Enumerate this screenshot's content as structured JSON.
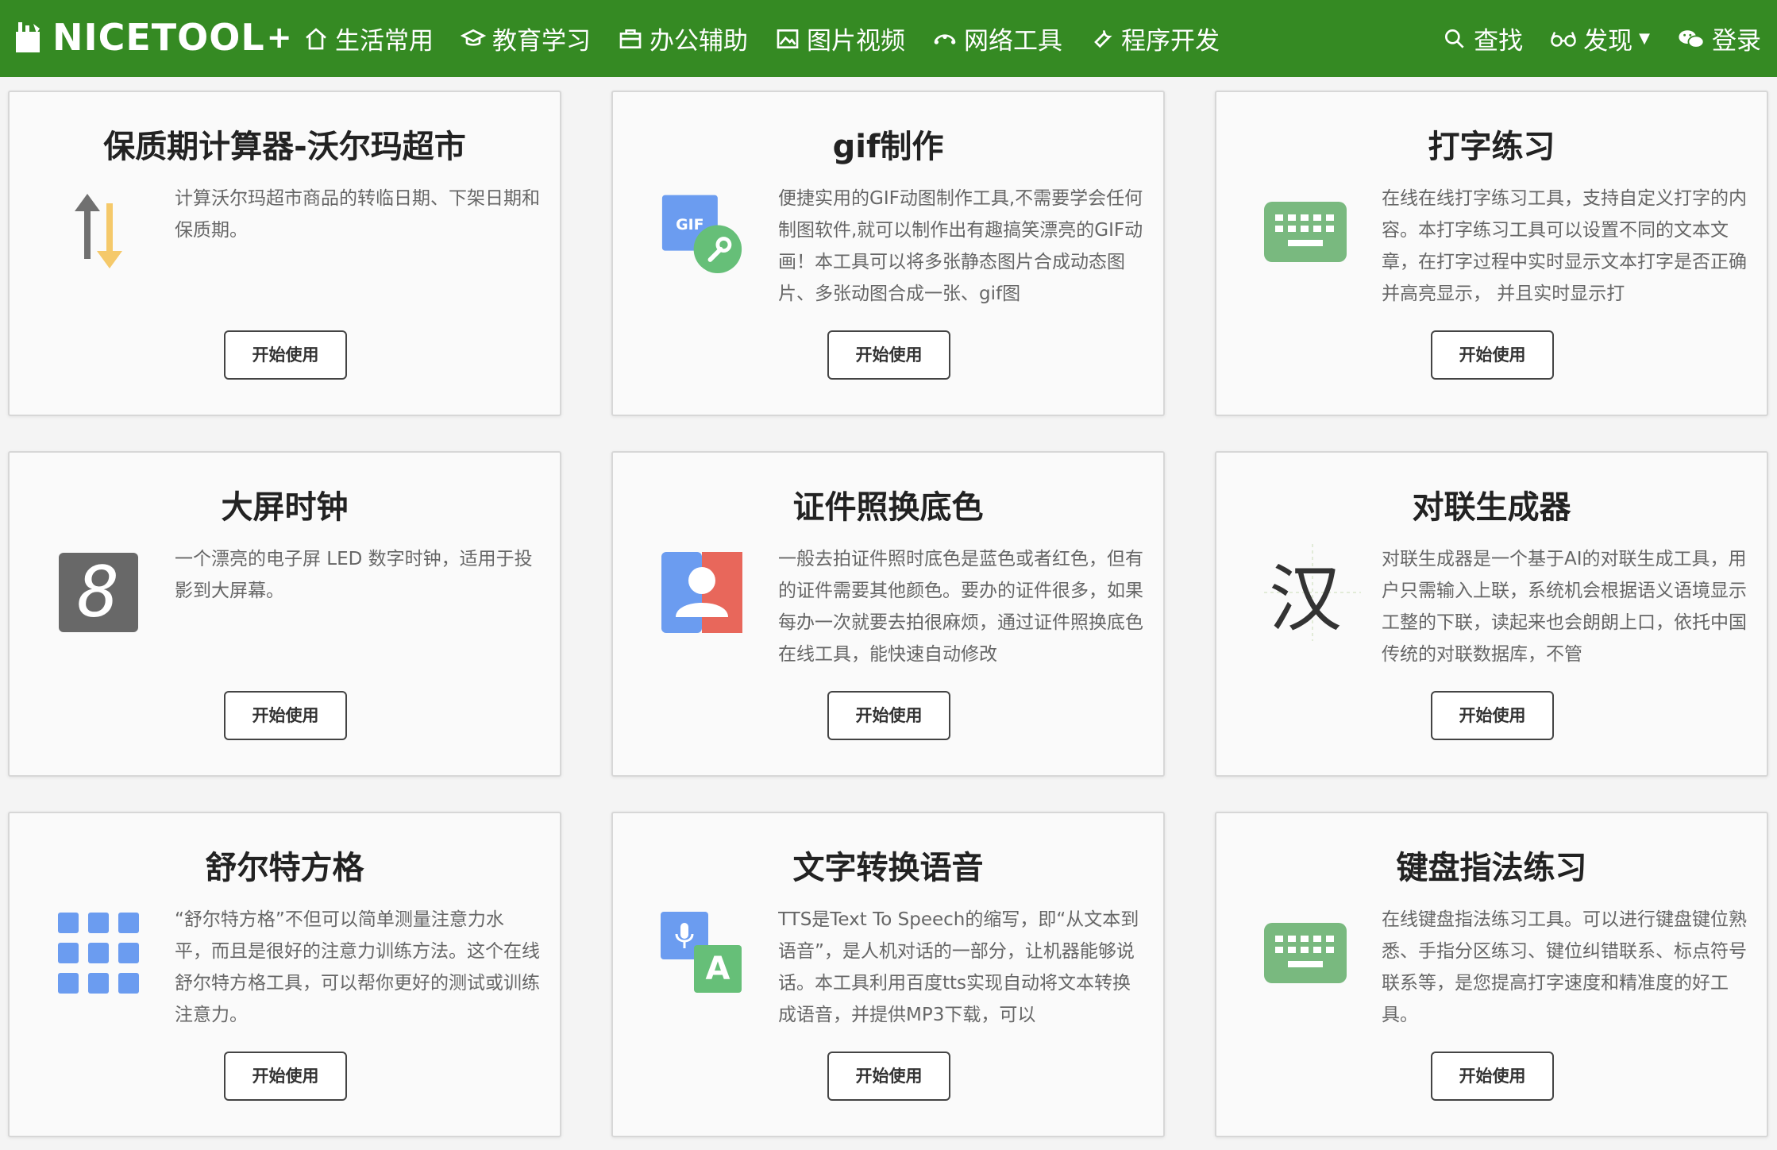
{
  "header": {
    "logo_text": "NICETOOL",
    "menu": [
      {
        "label": "生活常用",
        "icon": "home-icon"
      },
      {
        "label": "教育学习",
        "icon": "graduation-cap-icon"
      },
      {
        "label": "办公辅助",
        "icon": "briefcase-icon"
      },
      {
        "label": "图片视频",
        "icon": "image-icon"
      },
      {
        "label": "网络工具",
        "icon": "network-icon"
      },
      {
        "label": "程序开发",
        "icon": "wrench-icon"
      }
    ],
    "right": [
      {
        "label": "查找",
        "icon": "search-icon"
      },
      {
        "label": "发现",
        "icon": "glasses-icon"
      },
      {
        "label": "登录",
        "icon": "wechat-icon"
      }
    ]
  },
  "cards": [
    {
      "title": "保质期计算器-沃尔玛超市",
      "desc": "计算沃尔玛超市商品的转临日期、下架日期和保质期。",
      "button": "开始使用",
      "icon": "sort-arrows-icon"
    },
    {
      "title": "gif制作",
      "desc": "便捷实用的GIF动图制作工具,不需要学会任何制图软件,就可以制作出有趣搞笑漂亮的GIF动画！本工具可以将多张静态图片合成动态图片、多张动图合成一张、gif图",
      "button": "开始使用",
      "icon": "gif-wrench-icon",
      "badge": "GIF"
    },
    {
      "title": "打字练习",
      "desc": "在线在线打字练习工具，支持自定义打字的内容。本打字练习工具可以设置不同的文本文章，在打字过程中实时显示文本打字是否正确并高亮显示， 并且实时显示打",
      "button": "开始使用",
      "icon": "keyboard-icon"
    },
    {
      "title": "大屏时钟",
      "desc": "一个漂亮的电子屏 LED 数字时钟，适用于投影到大屏幕。",
      "button": "开始使用",
      "icon": "led-digit-icon",
      "digit": "8"
    },
    {
      "title": "证件照换底色",
      "desc": "一般去拍证件照时底色是蓝色或者红色，但有的证件需要其他颜色。要办的证件很多，如果每办一次就要去拍很麻烦，通过证件照换底色在线工具，能快速自动修改",
      "button": "开始使用",
      "icon": "id-photo-icon"
    },
    {
      "title": "对联生成器",
      "desc": "对联生成器是一个基于AI的对联生成工具，用户只需输入上联，系统机会根据语义语境显示工整的下联，读起来也会朗朗上口，依托中国传统的对联数据库，不管",
      "button": "开始使用",
      "icon": "chinese-character-icon",
      "glyph": "汉"
    },
    {
      "title": "舒尔特方格",
      "desc": "“舒尔特方格”不但可以简单测量注意力水平，而且是很好的注意力训练方法。这个在线舒尔特方格工具，可以帮你更好的测试或训练注意力。",
      "button": "开始使用",
      "icon": "grid-squares-icon"
    },
    {
      "title": "文字转换语音",
      "desc": "TTS是Text To Speech的缩写，即“从文本到语音”，是人机对话的一部分，让机器能够说话。本工具利用百度tts实现自动将文本转换成语音，并提供MP3下载，可以",
      "button": "开始使用",
      "icon": "mic-letter-icon",
      "letter": "A"
    },
    {
      "title": "键盘指法练习",
      "desc": "在线键盘指法练习工具。可以进行键盘键位熟悉、手指分区练习、键位纠错联系、标点符号联系等，是您提高打字速度和精准度的好工具。",
      "button": "开始使用",
      "icon": "keyboard-icon"
    }
  ]
}
